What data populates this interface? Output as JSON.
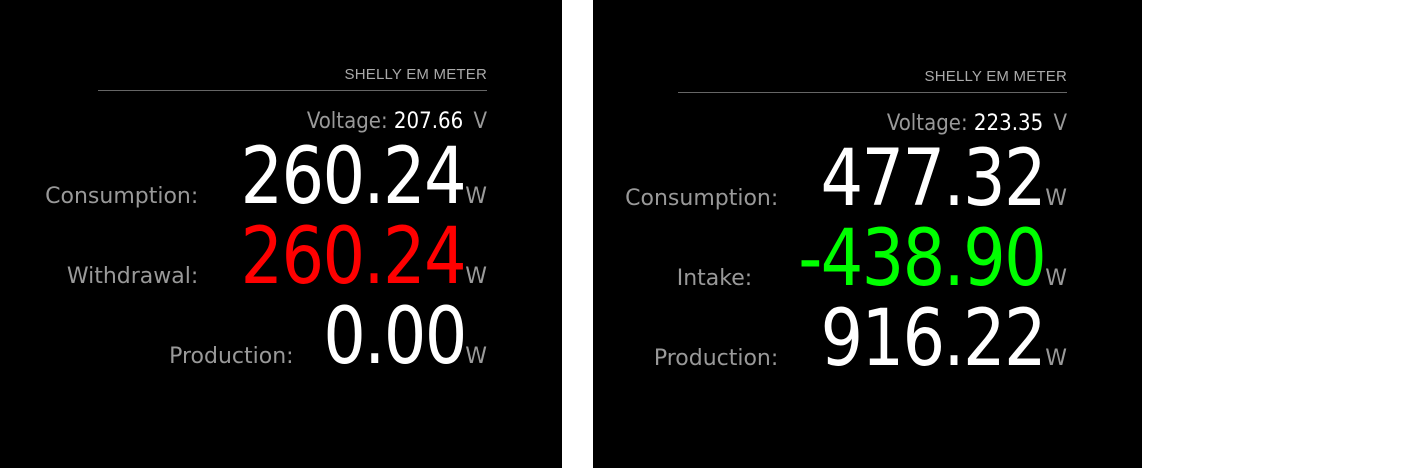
{
  "colors": {
    "background": "#000000",
    "label": "#999999",
    "value": "#ffffff",
    "withdrawal": "#ff0000",
    "intake": "#00ff00"
  },
  "panels": [
    {
      "title": "SHELLY EM METER",
      "voltage": {
        "label": "Voltage:",
        "value": "207.66",
        "unit": "V"
      },
      "rows": [
        {
          "label": "Consumption:",
          "value": "260.24",
          "unit": "W"
        },
        {
          "label": "Withdrawal:",
          "value": "260.24",
          "unit": "W"
        },
        {
          "label": "Production:",
          "value": "0.00",
          "unit": "W"
        }
      ]
    },
    {
      "title": "SHELLY EM METER",
      "voltage": {
        "label": "Voltage:",
        "value": "223.35",
        "unit": "V"
      },
      "rows": [
        {
          "label": "Consumption:",
          "value": "477.32",
          "unit": "W"
        },
        {
          "label": "Intake:",
          "value": "-438.90",
          "unit": "W"
        },
        {
          "label": "Production:",
          "value": "916.22",
          "unit": "W"
        }
      ]
    }
  ]
}
